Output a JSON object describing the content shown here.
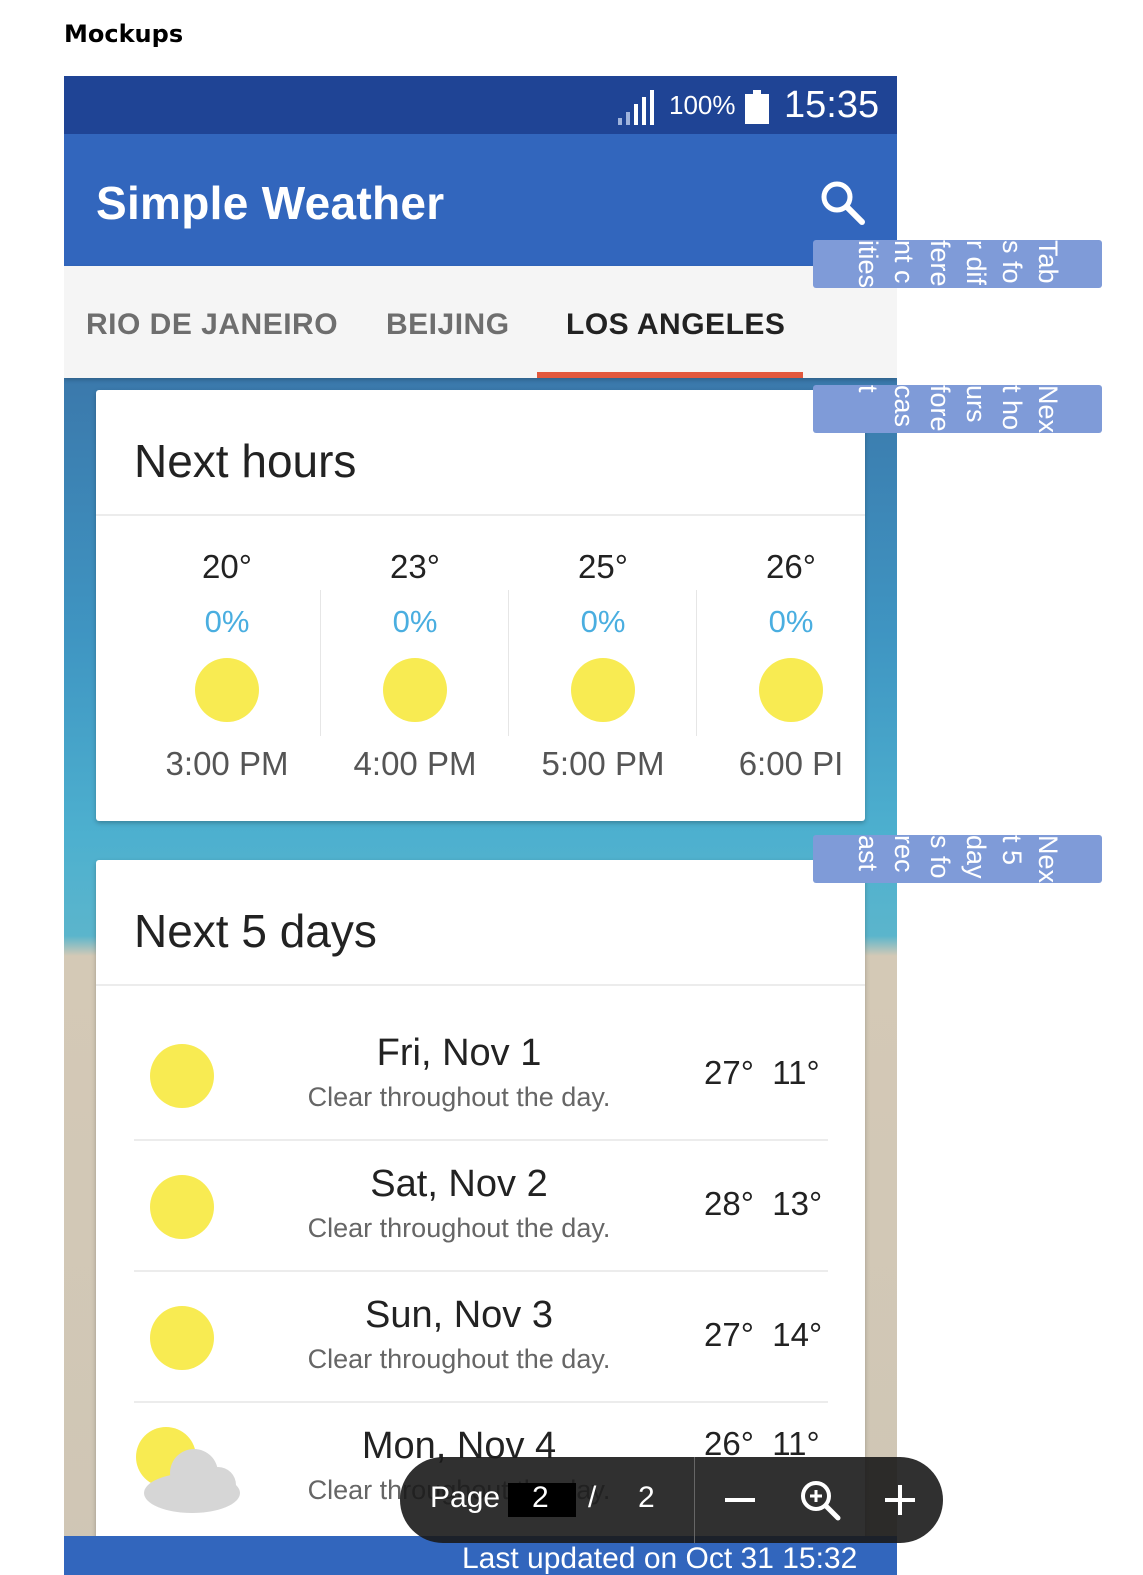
{
  "document": {
    "heading": "Mockups"
  },
  "status_bar": {
    "battery": "100%",
    "time": "15:35"
  },
  "app_bar": {
    "title": "Simple Weather",
    "search_icon": "search-icon"
  },
  "tabs": [
    {
      "label": "RIO DE JANEIRO",
      "active": false
    },
    {
      "label": "BEIJING",
      "active": false
    },
    {
      "label": "LOS ANGELES",
      "active": true
    }
  ],
  "next_hours": {
    "title": "Next hours",
    "items": [
      {
        "temp": "20°",
        "precip": "0%",
        "icon": "sun-icon",
        "time": "3:00 PM"
      },
      {
        "temp": "23°",
        "precip": "0%",
        "icon": "sun-icon",
        "time": "4:00 PM"
      },
      {
        "temp": "25°",
        "precip": "0%",
        "icon": "sun-icon",
        "time": "5:00 PM"
      },
      {
        "temp": "26°",
        "precip": "0%",
        "icon": "sun-icon",
        "time": "6:00 PI"
      }
    ]
  },
  "next_days": {
    "title": "Next 5 days",
    "items": [
      {
        "date": "Fri, Nov 1",
        "desc": "Clear throughout the day.",
        "high": "27°",
        "low": "11°",
        "icon": "sun-icon"
      },
      {
        "date": "Sat, Nov 2",
        "desc": "Clear throughout the day.",
        "high": "28°",
        "low": "13°",
        "icon": "sun-icon"
      },
      {
        "date": "Sun, Nov 3",
        "desc": "Clear throughout the day.",
        "high": "27°",
        "low": "14°",
        "icon": "sun-icon"
      },
      {
        "date": "Mon, Nov 4",
        "desc": "Clear throughout the day.",
        "high": "26°",
        "low": "11°",
        "icon": "partly-cloudy-icon"
      }
    ]
  },
  "footer": {
    "last_updated": "Last updated on Oct 31 15:32"
  },
  "annotations": [
    {
      "text": "Tabs for different cities"
    },
    {
      "text": "Next hours forecast"
    },
    {
      "text": "Next 5 days forecast"
    }
  ],
  "pager": {
    "label": "Page",
    "current": "2",
    "separator": "/",
    "total": "2"
  },
  "colors": {
    "status_bar": "#1f4495",
    "app_bar": "#3266bd",
    "tab_indicator": "#e2583d",
    "precip": "#4aaee0",
    "sun": "#f8eb52",
    "callout": "#7f9bd8"
  }
}
